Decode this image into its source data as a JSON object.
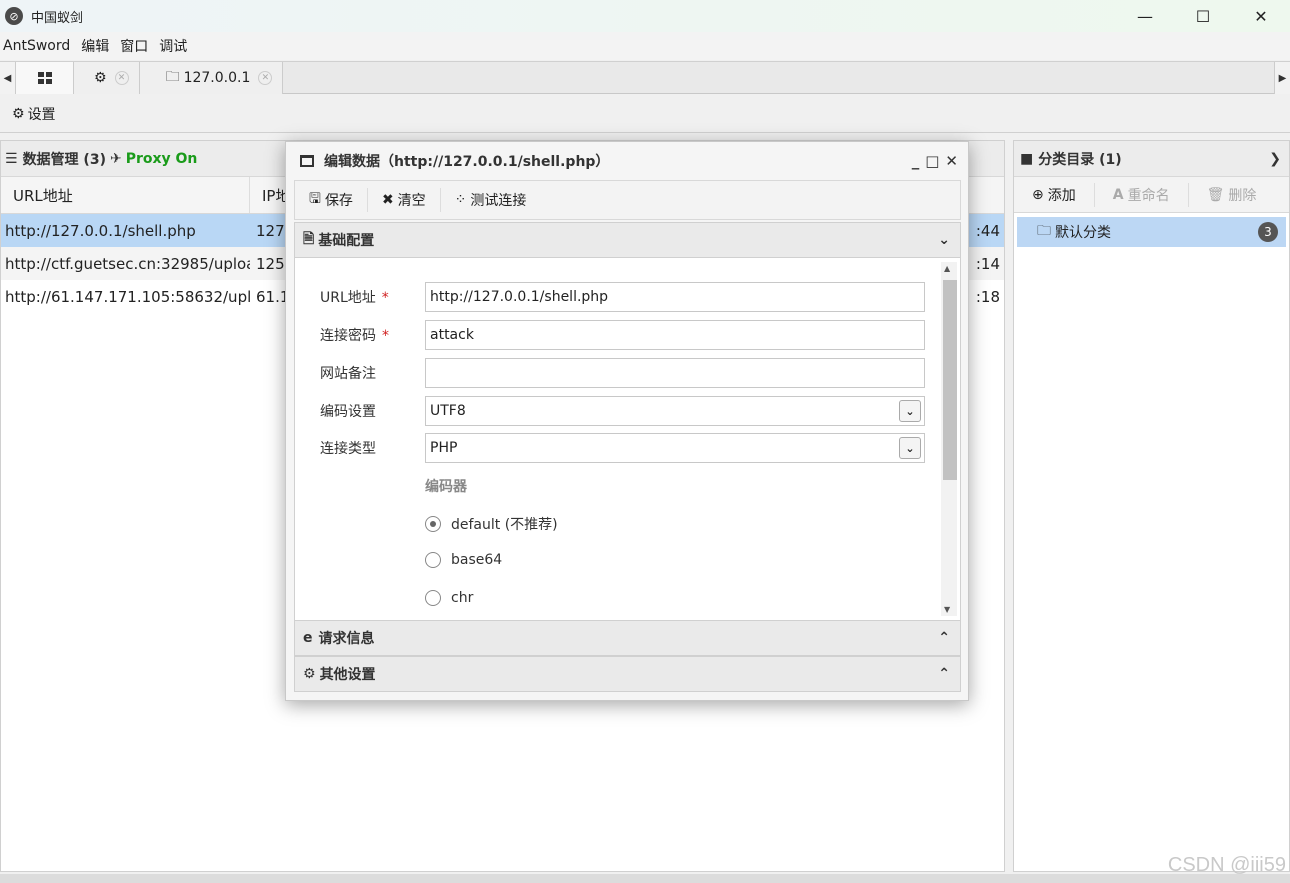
{
  "window": {
    "title": "中国蚁剑",
    "app_icon": "antsword-logo",
    "minimize": "—",
    "maximize": "☐",
    "close": "✕"
  },
  "menu": [
    "AntSword",
    "编辑",
    "窗口",
    "调试"
  ],
  "tabs": {
    "home_icon": "grid-icon",
    "settings_icon": "gear-icon",
    "shell_tab": "127.0.0.1"
  },
  "toolbar": {
    "settings_label": "设置"
  },
  "data_panel": {
    "title": "数据管理 (3)",
    "proxy": "Proxy On",
    "columns": {
      "url": "URL地址",
      "ip": "IP地"
    },
    "rows": [
      {
        "url": "http://127.0.0.1/shell.php",
        "ip": "127",
        "time": ":44"
      },
      {
        "url": "http://ctf.guetsec.cn:32985/uploa",
        "ip": "125",
        "time": ":14"
      },
      {
        "url": "http://61.147.171.105:58632/uplo",
        "ip": "61.1",
        "time": ":18"
      }
    ]
  },
  "category_panel": {
    "title": "分类目录 (1)",
    "add": "添加",
    "rename": "重命名",
    "delete": "删除",
    "items": [
      {
        "label": "默认分类",
        "count": "3"
      }
    ]
  },
  "modal": {
    "title": "编辑数据（http://127.0.0.1/shell.php）",
    "save": "保存",
    "clear": "清空",
    "test": "测试连接",
    "basic_section": "基础配置",
    "request_section": "请求信息",
    "other_section": "其他设置",
    "fields": {
      "url_label": "URL地址",
      "url_value": "http://127.0.0.1/shell.php",
      "password_label": "连接密码",
      "password_value": "attack",
      "note_label": "网站备注",
      "note_value": "",
      "encoding_label": "编码设置",
      "encoding_value": "UTF8",
      "type_label": "连接类型",
      "type_value": "PHP"
    },
    "encoder_label": "编码器",
    "encoders": [
      "default (不推荐)",
      "base64",
      "chr"
    ],
    "selected_encoder": "default (不推荐)"
  },
  "watermark": "CSDN @iii59"
}
